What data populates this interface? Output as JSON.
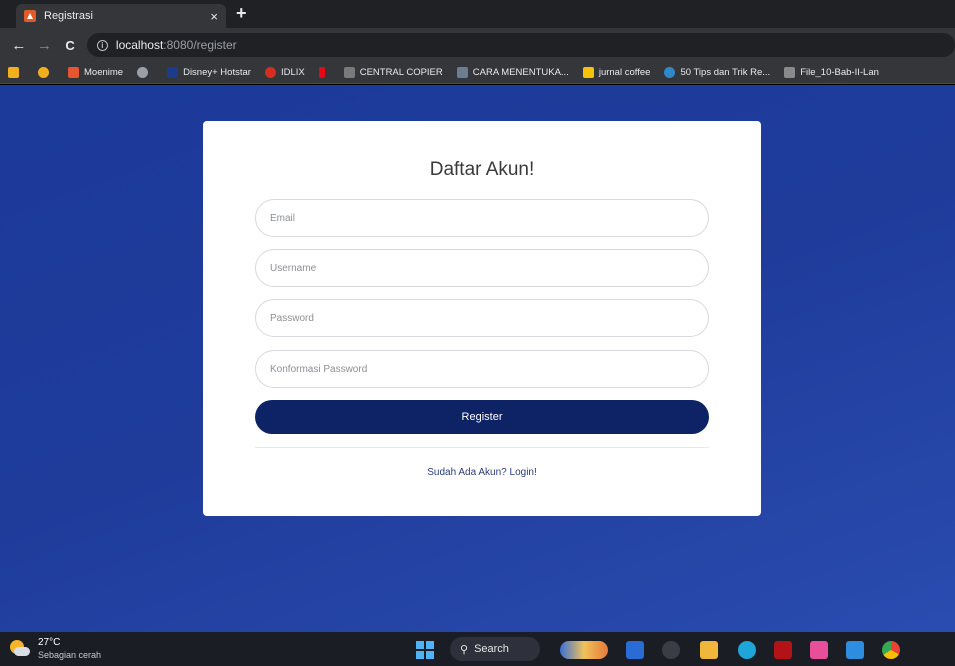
{
  "tab": {
    "title": "Registrasi",
    "close": "×",
    "new": "+"
  },
  "address": {
    "back": "←",
    "forward": "→",
    "reload": "C",
    "info": "i",
    "host": "localhost",
    "path": ":8080/register"
  },
  "bookmarks": [
    {
      "label": "",
      "color": "#f2b01e"
    },
    {
      "label": "",
      "color": "#f2b01e"
    },
    {
      "label": "Moenime",
      "color": "#e4572e"
    },
    {
      "label": "",
      "color": "#9aa0a6"
    },
    {
      "label": "Disney+ Hotstar",
      "color": "#1b3c8c"
    },
    {
      "label": "IDLIX",
      "color": "#d62d20"
    },
    {
      "label": "",
      "color": "#e50914"
    },
    {
      "label": "CENTRAL COPIER",
      "color": "#7a7a7a"
    },
    {
      "label": "CARA MENENTUKA...",
      "color": "#6b7d8f"
    },
    {
      "label": "jurnal coffee",
      "color": "#f4c20d"
    },
    {
      "label": "50 Tips dan Trik Re...",
      "color": "#2f88c9"
    },
    {
      "label": "File_10-Bab-II-Lan",
      "color": "#8a8a8a"
    }
  ],
  "form": {
    "title": "Daftar Akun!",
    "email_placeholder": "Email",
    "username_placeholder": "Username",
    "password_placeholder": "Password",
    "confirm_placeholder": "Konformasi Password",
    "register_label": "Register",
    "login_link": "Sudah Ada Akun? Login!"
  },
  "taskbar": {
    "temp": "27°C",
    "weather": "Sebagian cerah",
    "search": "Search"
  },
  "colors": {
    "page_bg": "#1f3c9b",
    "button": "#0e2366"
  }
}
